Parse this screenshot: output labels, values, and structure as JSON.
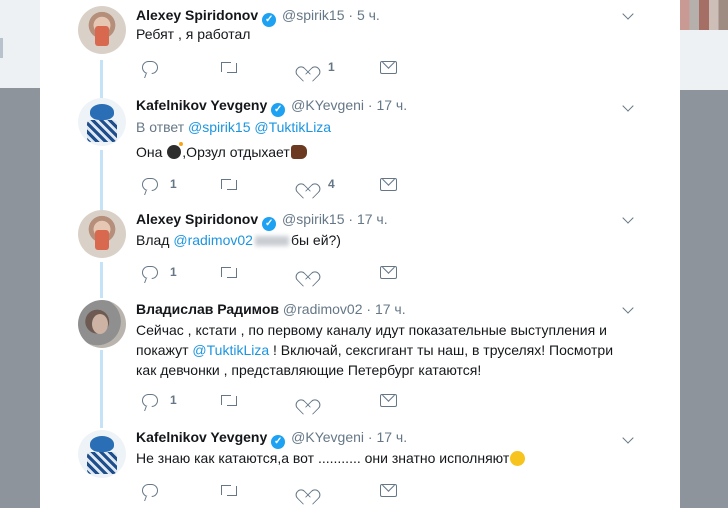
{
  "colors": {
    "link": "#1b95e0",
    "verified": "#1da1f2",
    "muted": "#657786",
    "thread_line": "#c4e3f7",
    "text": "#14171a"
  },
  "tweets": [
    {
      "avatar": "mirror-selfie-avatar",
      "name": "Alexey Spiridonov",
      "verified": true,
      "handle": "@spirik15",
      "dot": "·",
      "time": "5 ч.",
      "reply_prefix": "",
      "reply_mentions": [],
      "text": "Ребят , я работал",
      "reply_count": "",
      "retweet_count": "",
      "like_count": "1"
    },
    {
      "avatar": "cartoon-avatar",
      "name": "Kafelnikov Yevgeny",
      "verified": true,
      "handle": "@KYevgeni",
      "dot": "·",
      "time": "17 ч.",
      "reply_prefix": "В ответ",
      "reply_mentions": [
        "@spirik15",
        "@TuktikLiza"
      ],
      "text_parts": [
        "Она ",
        ",Орзул отдыхает"
      ],
      "emojis": [
        "bomb-emoji",
        "thumbs-down-emoji"
      ],
      "reply_count": "1",
      "retweet_count": "",
      "like_count": "4"
    },
    {
      "avatar": "mirror-selfie-avatar",
      "name": "Alexey Spiridonov",
      "verified": true,
      "handle": "@spirik15",
      "dot": "·",
      "time": "17 ч.",
      "text_parts": [
        "Влад ",
        "@radimov02",
        "бы ей?)"
      ],
      "reply_count": "1",
      "retweet_count": "",
      "like_count": ""
    },
    {
      "avatar": "photo-avatar",
      "name": "Владислав Радимов",
      "verified": false,
      "handle": "@radimov02",
      "dot": "·",
      "time": "17 ч.",
      "text_parts": [
        "Сейчас , кстати , по первому каналу идут показательные выступления и покажут ",
        "@TuktikLiza",
        " ! Включай, сексгигант ты наш, в труселях! Посмотри как девчонки , представляющие Петербург катаются!"
      ],
      "reply_count": "1",
      "retweet_count": "",
      "like_count": ""
    },
    {
      "avatar": "cartoon-avatar",
      "name": "Kafelnikov Yevgeny",
      "verified": true,
      "handle": "@KYevgeni",
      "dot": "·",
      "time": "17 ч.",
      "text": "Не знаю как катаются,а вот ........... они знатно исполняют",
      "emoji": "winking-face-emoji",
      "reply_count": "",
      "retweet_count": "",
      "like_count": ""
    }
  ]
}
